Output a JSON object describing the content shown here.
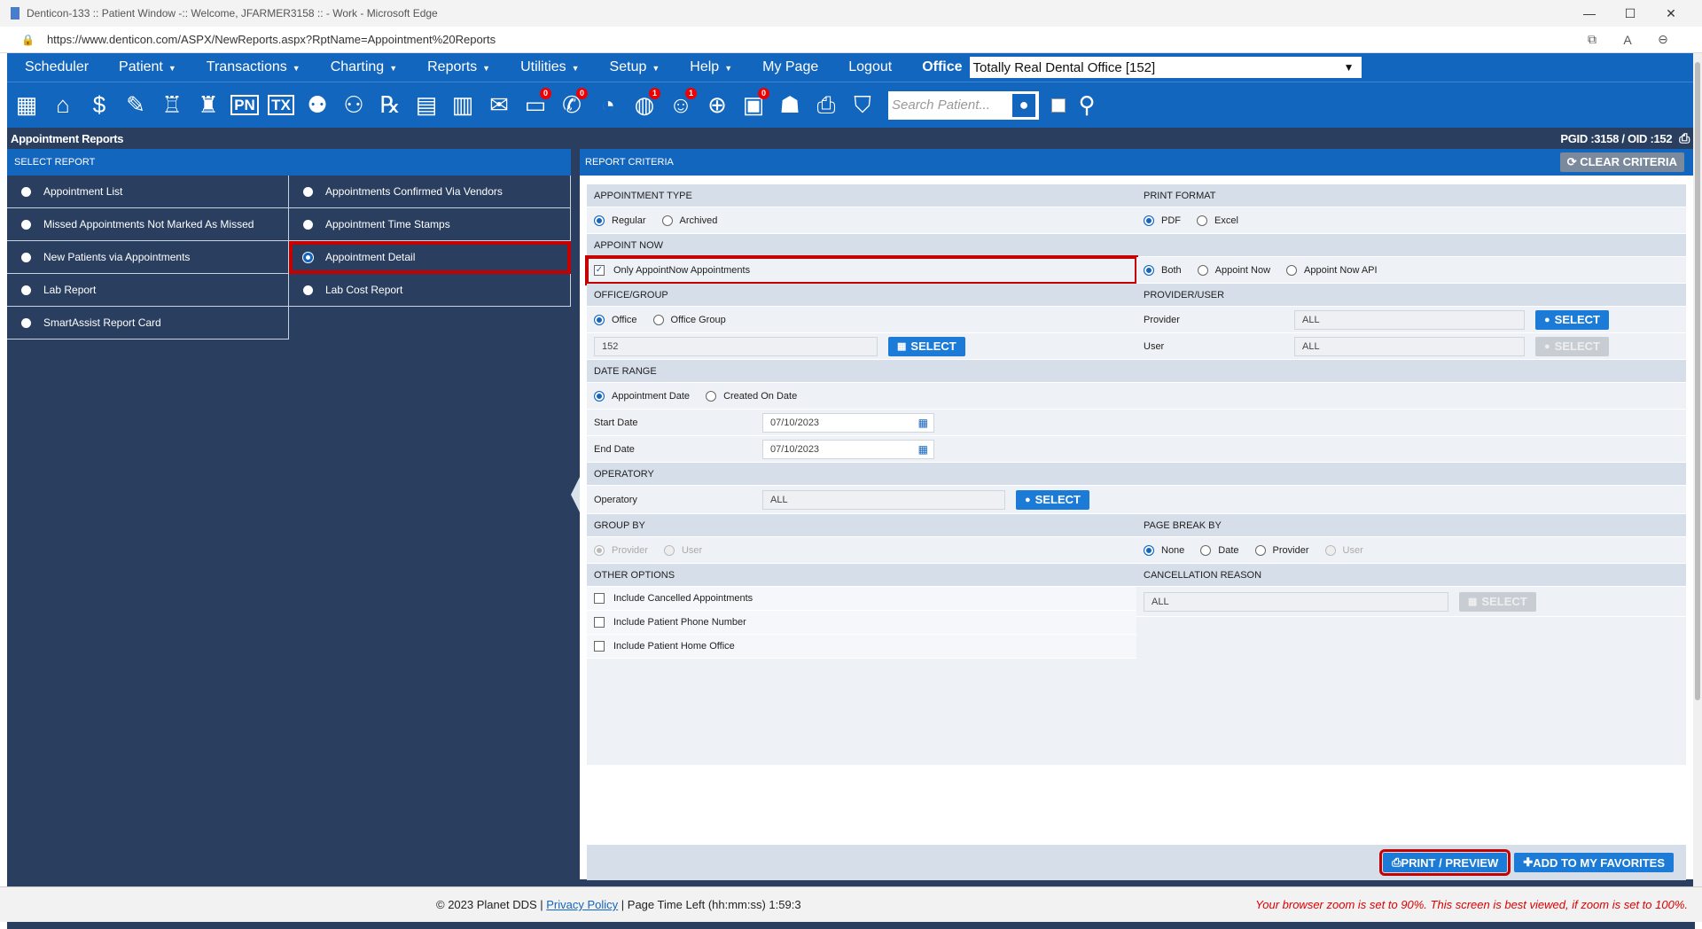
{
  "browser": {
    "window_title": "Denticon-133 :: Patient Window -:: Welcome, JFARMER3158 :: - Work - Microsoft Edge",
    "url": "https://www.denticon.com/ASPX/NewReports.aspx?RptName=Appointment%20Reports",
    "minimize": "—",
    "maximize": "☐",
    "close": "✕"
  },
  "menu": {
    "items": [
      "Scheduler",
      "Patient",
      "Transactions",
      "Charting",
      "Reports",
      "Utilities",
      "Setup",
      "Help",
      "My Page",
      "Logout"
    ],
    "caret": "▼",
    "office_label": "Office",
    "office_value": "Totally Real Dental Office [152]"
  },
  "toolbar": {
    "search_placeholder": "Search Patient...",
    "badges": {
      "messages": "0",
      "sms": "0",
      "globe": "1",
      "help": "1",
      "clipboard": "0"
    }
  },
  "page": {
    "title": "Appointment Reports",
    "ids": "PGID :3158  /  OID :152"
  },
  "left": {
    "header": "SELECT REPORT",
    "reports": [
      {
        "label": "Appointment List",
        "selected": false
      },
      {
        "label": "Appointments Confirmed Via Vendors",
        "selected": false
      },
      {
        "label": "Missed Appointments Not Marked As Missed",
        "selected": false
      },
      {
        "label": "Appointment Time Stamps",
        "selected": false
      },
      {
        "label": "New Patients via Appointments",
        "selected": false
      },
      {
        "label": "Appointment Detail",
        "selected": true
      },
      {
        "label": "Lab Report",
        "selected": false
      },
      {
        "label": "Lab Cost Report",
        "selected": false
      },
      {
        "label": "SmartAssist Report Card",
        "selected": false
      }
    ]
  },
  "right": {
    "header": "REPORT CRITERIA",
    "clear": "CLEAR CRITERIA",
    "appt_type": {
      "title": "APPOINTMENT TYPE",
      "regular": "Regular",
      "archived": "Archived"
    },
    "print_format": {
      "title": "PRINT FORMAT",
      "pdf": "PDF",
      "excel": "Excel"
    },
    "appoint_now": {
      "title": "APPOINT NOW",
      "only": "Only AppointNow Appointments",
      "both": "Both",
      "now": "Appoint Now",
      "api": "Appoint Now API"
    },
    "office_group": {
      "title": "OFFICE/GROUP",
      "office": "Office",
      "group": "Office Group",
      "value": "152",
      "select": "SELECT"
    },
    "provider_user": {
      "title": "PROVIDER/USER",
      "provider": "Provider",
      "provider_value": "ALL",
      "user": "User",
      "user_value": "ALL",
      "select": "SELECT"
    },
    "date_range": {
      "title": "DATE RANGE",
      "appt_date": "Appointment Date",
      "created": "Created On Date",
      "start_label": "Start Date",
      "start": "07/10/2023",
      "end_label": "End Date",
      "end": "07/10/2023"
    },
    "operatory": {
      "title": "OPERATORY",
      "label": "Operatory",
      "value": "ALL",
      "select": "SELECT"
    },
    "group_by": {
      "title": "GROUP BY",
      "provider": "Provider",
      "user": "User"
    },
    "page_break": {
      "title": "PAGE BREAK BY",
      "none": "None",
      "date": "Date",
      "provider": "Provider",
      "user": "User"
    },
    "other": {
      "title": "OTHER OPTIONS",
      "opt1": "Include Cancelled Appointments",
      "opt2": "Include Patient Phone Number",
      "opt3": "Include Patient Home Office"
    },
    "cancel_reason": {
      "title": "CANCELLATION REASON",
      "value": "ALL",
      "select": "SELECT"
    },
    "print": "PRINT / PREVIEW",
    "favorites": "ADD TO MY FAVORITES"
  },
  "footer": {
    "copyright": "© 2023 Planet DDS | ",
    "privacy": "Privacy Policy",
    "time": " |  Page Time Left (hh:mm:ss) 1:59:3",
    "zoom_note": "Your browser zoom is set to 90%. This screen is best viewed, if zoom is set to 100%."
  }
}
